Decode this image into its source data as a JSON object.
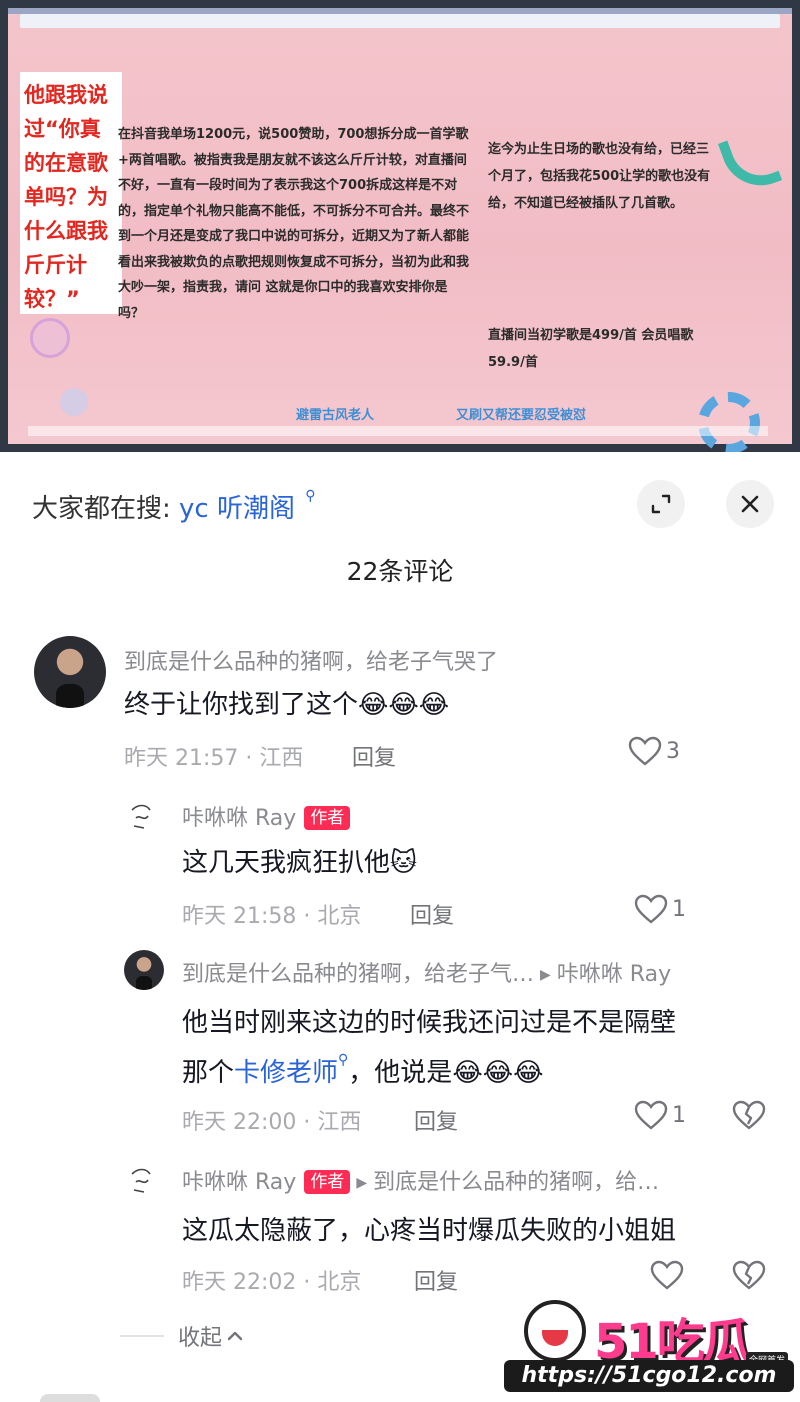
{
  "video": {
    "quote_box": "他跟我说过“你真的在意歌单吗？为什么跟我斤斤计较？”",
    "left_text": "在抖音我单场1200元，说500赞助，700想拆分成一首学歌+两首唱歌。被指责我是朋友就不该这么斤斤计较，对直播间不好，一直有一段时间为了表示我这个700拆成这样是不对的，指定单个礼物只能高不能低，不可拆分不可合并。最终不到一个月还是变成了我口中说的可拆分，近期又为了新人都能看出来我被欺负的点歌把规则恢复成不可拆分，当初为此和我大吵一架，指责我，请问 这就是你口中的我喜欢安排你是吗？",
    "right_text_1": "迄今为止生日场的歌也没有给，已经三个月了，包括我花500让学的歌也没有给，不知道已经被插队了几首歌。",
    "right_text_2": "直播间当初学歌是499/首 会员唱歌59.9/首",
    "footer_left": "避雷古风老人",
    "footer_right": "又刷又帮还要忍受被怼"
  },
  "sheet": {
    "search_prefix": "大家都在搜:",
    "search_keyword": "yc 听潮阁",
    "search_icon": "search-icon",
    "expand_icon": "expand-icon",
    "close_icon": "close-icon",
    "comment_count": "22条评论"
  },
  "comments": [
    {
      "username": "到底是什么品种的猪啊，给老子气哭了",
      "text": "终于让你找到了这个",
      "emoji": "😂😂😂",
      "meta": "昨天 21:57 · 江西",
      "reply_label": "回复",
      "likes": "3"
    },
    {
      "username": "咔咻咻 Ray",
      "author_tag": "作者",
      "text": "这几天我疯狂扒他",
      "emoji": "🐱",
      "meta": "昨天 21:58 · 北京",
      "reply_label": "回复",
      "likes": "1"
    },
    {
      "username": "到底是什么品种的猪啊，给老子气…",
      "reply_to": "咔咻咻 Ray",
      "text_line1": "他当时刚来这边的时候我还问过是不是隔壁",
      "text_line2_prefix": "那个",
      "text_line2_keyword": "卡修老师",
      "text_line2_suffix": "，他说是",
      "emoji": "😂😂😂",
      "meta": "昨天 22:00 · 江西",
      "reply_label": "回复",
      "likes": "1"
    },
    {
      "username": "咔咻咻 Ray",
      "author_tag": "作者",
      "reply_to": "到底是什么品种的猪啊，给…",
      "text": "这瓜太隐蔽了，心疼当时爆瓜失败的小姐姐",
      "meta": "昨天 22:02 · 北京",
      "reply_label": "回复"
    }
  ],
  "collapse_label": "收起",
  "watermark": {
    "logo": "51吃瓜",
    "badge": "全网首发",
    "url": "https://51cgo12.com"
  }
}
